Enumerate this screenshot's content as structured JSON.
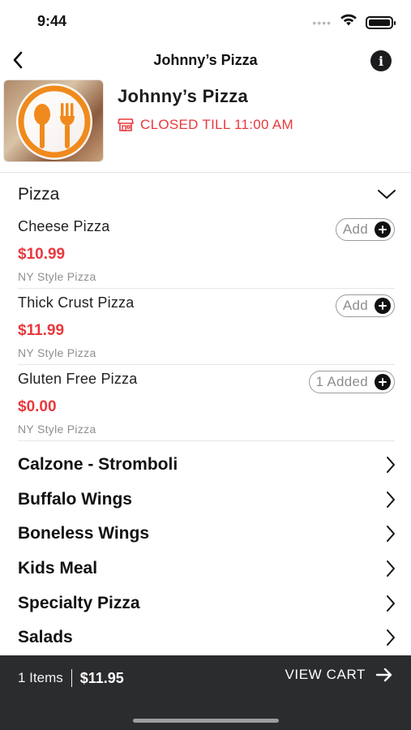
{
  "status_bar": {
    "time": "9:44",
    "icons": [
      "cellular-dots-icon",
      "wifi-icon",
      "battery-icon"
    ]
  },
  "nav": {
    "title": "Johnny’s Pizza",
    "back_icon": "chevron-left-icon",
    "info_icon": "info-icon"
  },
  "restaurant": {
    "name": "Johnny’s Pizza",
    "status": "CLOSED TILL 11:00 AM",
    "status_icon": "storefront-icon",
    "logo_icon": "spoon-fork-logo"
  },
  "menu": {
    "open_category": {
      "label": "Pizza",
      "icon": "chevron-down-icon"
    },
    "items": [
      {
        "name": "Cheese Pizza",
        "price": "$10.99",
        "description": "NY Style Pizza",
        "button": "Add"
      },
      {
        "name": "Thick Crust Pizza",
        "price": "$11.99",
        "description": "NY Style Pizza",
        "button": "Add"
      },
      {
        "name": "Gluten Free Pizza",
        "price": "$0.00",
        "description": "NY Style Pizza",
        "button": "1 Added"
      }
    ],
    "categories": [
      {
        "label": "Calzone - Stromboli"
      },
      {
        "label": "Buffalo Wings"
      },
      {
        "label": "Boneless Wings"
      },
      {
        "label": "Kids Meal"
      },
      {
        "label": "Specialty Pizza"
      },
      {
        "label": "Salads"
      }
    ]
  },
  "cart": {
    "items_count": "1 Items",
    "total": "$11.95",
    "action": "VIEW CART",
    "action_icon": "arrow-right-icon"
  },
  "colors": {
    "accent_red": "#e8383d",
    "cart_bar": "#2b2c2e",
    "logo_orange": "#f08a1c"
  }
}
